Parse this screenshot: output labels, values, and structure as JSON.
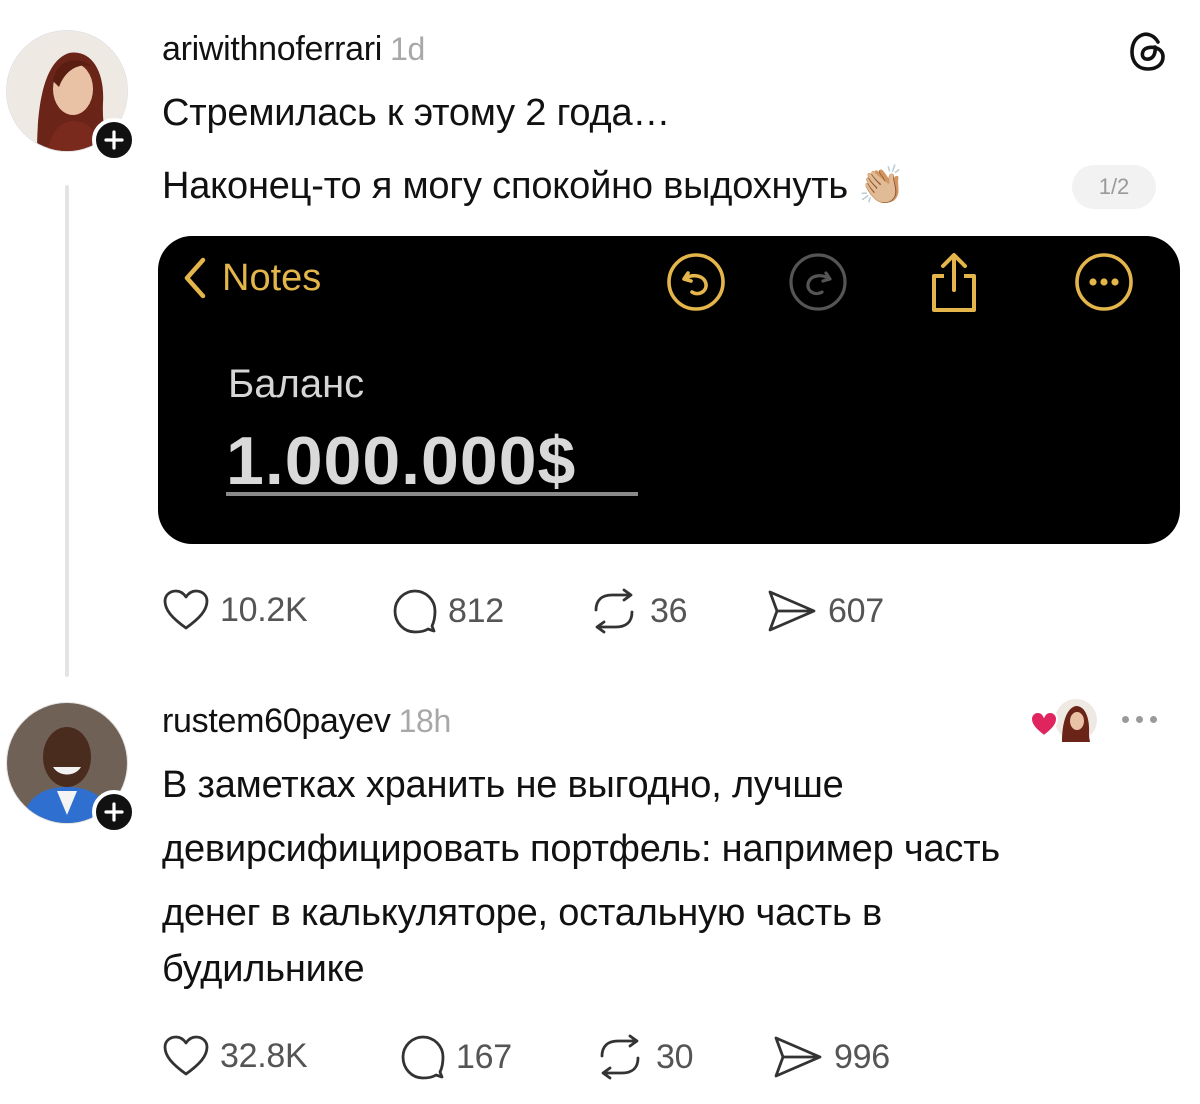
{
  "post": {
    "username": "ariwithnoferrari",
    "time": "1d",
    "lines": [
      "Стремилась к этому 2 года…",
      "Наконец-то я могу спокойно выдохнуть 👏🏼"
    ],
    "image_counter": "1/2",
    "notes_screenshot": {
      "back_label": "Notes",
      "title": "Баланс",
      "amount": "1.000.000$",
      "accent_color": "#e3b54a"
    },
    "actions": {
      "likes": "10.2K",
      "comments": "812",
      "reposts": "36",
      "shares": "607"
    }
  },
  "reply": {
    "username": "rustem60payev",
    "time": "18h",
    "lines": [
      "В заметках хранить не выгодно, лучше",
      "девирсифицировать портфель: например часть",
      "денег в калькуляторе, остальную часть в",
      "будильнике"
    ],
    "actions": {
      "likes": "32.8K",
      "comments": "167",
      "reposts": "30",
      "shares": "996"
    }
  },
  "icons": {
    "app_logo": "threads-logo-icon",
    "like": "heart-icon",
    "comment": "comment-bubble-icon",
    "repost": "repost-icon",
    "share": "share-paper-plane-icon",
    "follow": "plus-icon",
    "more": "more-dots-icon"
  },
  "colors": {
    "liked_heart": "#e0245e",
    "meta_gray": "#a8a8a8",
    "thread_line": "#e4e4e4"
  }
}
